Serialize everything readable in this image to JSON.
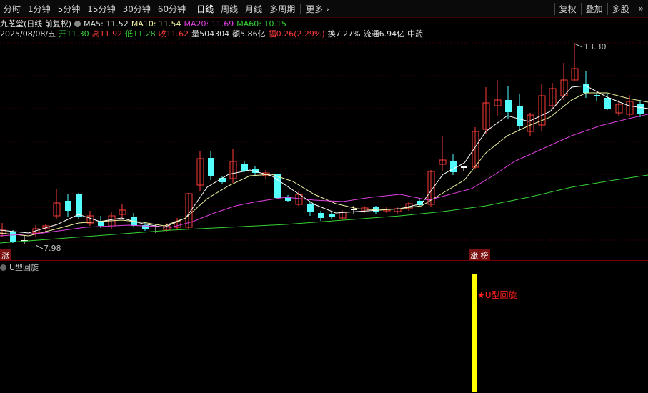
{
  "toolbar": {
    "periods": [
      "分时",
      "1分钟",
      "5分钟",
      "15分钟",
      "30分钟",
      "60分钟",
      "日线",
      "周线",
      "月线",
      "多周期",
      "更多"
    ],
    "more_chevron": "›",
    "active": "日线",
    "right_buttons": [
      "复权",
      "叠加",
      "多股",
      "»"
    ]
  },
  "quote": {
    "name": "九芝堂(日线 前复权)",
    "ma5": "MA5: 11.52",
    "ma10": "MA10: 11.54",
    "ma20": "MA20: 11.69",
    "ma60": "MA60: 10.15",
    "date": "2025/08/08/五",
    "open": "开11.30",
    "high": "高11.92",
    "low": "低11.28",
    "close": "收11.62",
    "volume": "量504304",
    "amount": "额5.86亿",
    "change": "幅0.26(2.29%)",
    "turnover": "换7.27%",
    "float": "流通6.94亿",
    "sector": "中药"
  },
  "chart": {
    "max_label": "13.30",
    "min_label": "7.98",
    "left_marker": "涨",
    "badge": "涨 榜",
    "colors": {
      "up": "#ff3c3c",
      "down": "#54ffff",
      "flat": "#ffffff",
      "ma5": "#ffffff",
      "ma10": "#f0f0a0",
      "ma20": "#e040e0",
      "ma60": "#36d236"
    }
  },
  "indicator": {
    "title": "U型回旋",
    "signal_label": "★U型回旋",
    "bar_color": "#ffff00",
    "signal_color": "#ff2020"
  }
}
